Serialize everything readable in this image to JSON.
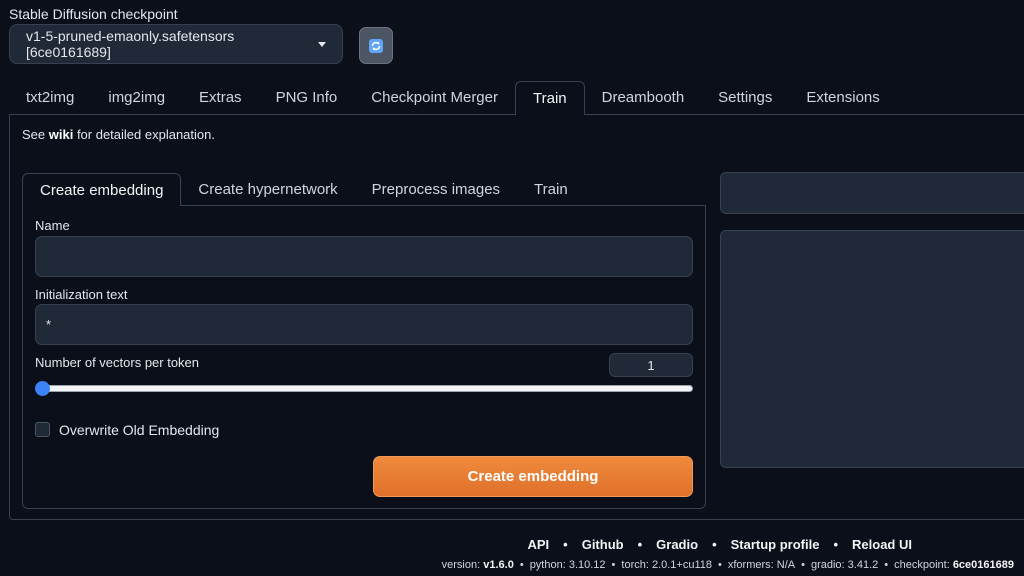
{
  "checkpoint": {
    "label": "Stable Diffusion checkpoint",
    "selected": "v1-5-pruned-emaonly.safetensors [6ce0161689]",
    "refresh_icon": "refresh-icon"
  },
  "main_tabs": [
    {
      "label": "txt2img"
    },
    {
      "label": "img2img"
    },
    {
      "label": "Extras"
    },
    {
      "label": "PNG Info"
    },
    {
      "label": "Checkpoint Merger"
    },
    {
      "label": "Train",
      "active": true
    },
    {
      "label": "Dreambooth"
    },
    {
      "label": "Settings"
    },
    {
      "label": "Extensions"
    }
  ],
  "wiki": {
    "prefix": "See ",
    "link": "wiki",
    "suffix": " for detailed explanation."
  },
  "sub_tabs": [
    {
      "label": "Create embedding",
      "active": true
    },
    {
      "label": "Create hypernetwork"
    },
    {
      "label": "Preprocess images"
    },
    {
      "label": "Train"
    }
  ],
  "form": {
    "name_label": "Name",
    "name_value": "",
    "init_label": "Initialization text",
    "init_value": "*",
    "vectors_label": "Number of vectors per token",
    "vectors_value": "1",
    "overwrite_label": "Overwrite Old Embedding",
    "overwrite_checked": false,
    "create_button": "Create embedding"
  },
  "footer": {
    "links": [
      "API",
      "Github",
      "Gradio",
      "Startup profile",
      "Reload UI"
    ],
    "separator": "•",
    "version_label": "version: ",
    "version": "v1.6.0",
    "python": "python: 3.10.12",
    "torch": "torch: 2.0.1+cu118",
    "xformers": "xformers: N/A",
    "gradio": "gradio: 3.41.2",
    "checkpoint_label": "checkpoint: ",
    "checkpoint": "6ce0161689"
  },
  "colors": {
    "accent": "#e0702a",
    "background": "#0b0f19",
    "slider": "#3b82f6"
  }
}
